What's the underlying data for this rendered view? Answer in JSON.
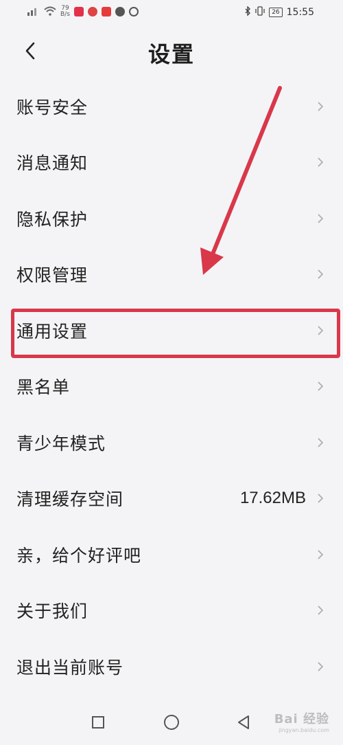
{
  "status_bar": {
    "network_speed_value": "79",
    "network_speed_unit": "B/s",
    "time": "15:55",
    "battery": "26"
  },
  "header": {
    "title": "设置"
  },
  "settings": {
    "items": [
      {
        "label": "账号安全",
        "value": ""
      },
      {
        "label": "消息通知",
        "value": ""
      },
      {
        "label": "隐私保护",
        "value": ""
      },
      {
        "label": "权限管理",
        "value": ""
      },
      {
        "label": "通用设置",
        "value": ""
      },
      {
        "label": "黑名单",
        "value": ""
      },
      {
        "label": "青少年模式",
        "value": ""
      },
      {
        "label": "清理缓存空间",
        "value": "17.62MB"
      },
      {
        "label": "亲，给个好评吧",
        "value": ""
      },
      {
        "label": "关于我们",
        "value": ""
      },
      {
        "label": "退出当前账号",
        "value": ""
      }
    ]
  },
  "annotation": {
    "highlighted_item": "通用设置",
    "color": "#d8384a"
  },
  "watermark": {
    "text": "Bai 经验",
    "sub": "jingyan.baidu.com"
  }
}
